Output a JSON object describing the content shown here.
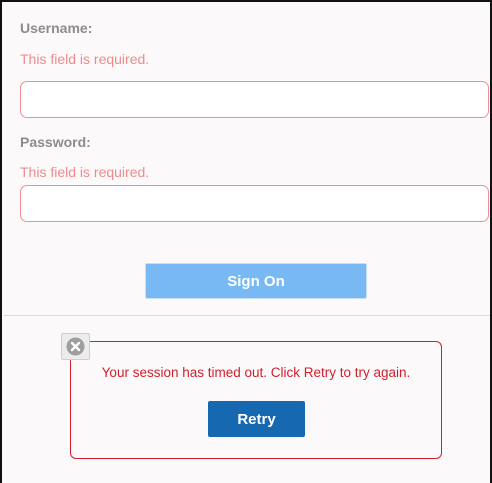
{
  "login": {
    "username": {
      "label": "Username:",
      "error": "This field is required.",
      "value": ""
    },
    "password": {
      "label": "Password:",
      "error": "This field is required.",
      "value": ""
    },
    "sign_on_label": "Sign On"
  },
  "session_alert": {
    "message": "Your session has timed out. Click Retry to try again.",
    "retry_label": "Retry",
    "close_icon": "close-circle-icon"
  },
  "colors": {
    "error_text": "#f08a8a",
    "input_border": "#ef8f93",
    "sign_on_button": "#78b9f3",
    "alert_red": "#d01f2a",
    "retry_button": "#1668b0"
  }
}
